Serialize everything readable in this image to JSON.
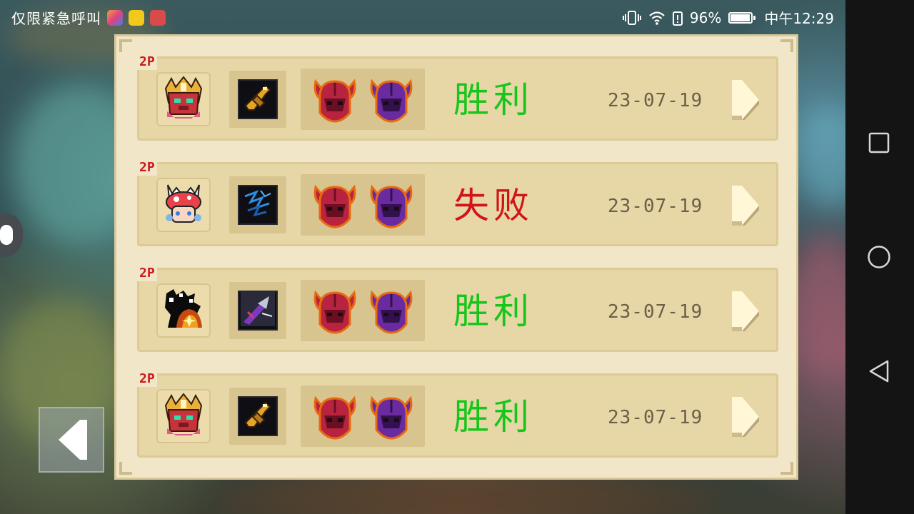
{
  "status_bar": {
    "carrier_text": "仅限紧急呼叫",
    "battery_percent": "96%",
    "battery_level": 0.96,
    "time": "中午12:29"
  },
  "records": [
    {
      "tag": "2P",
      "hero": "knight-red-hero",
      "weapon": "golden-gun-weapon",
      "result": "胜利",
      "result_color": "#17c61a",
      "date": "23-07-19"
    },
    {
      "tag": "2P",
      "hero": "mushroom-girl-hero",
      "weapon": "blue-lightning-weapon",
      "result": "失败",
      "result_color": "#d0141a",
      "date": "23-07-19"
    },
    {
      "tag": "2P",
      "hero": "shadow-flame-hero",
      "weapon": "drill-lance-weapon",
      "result": "胜利",
      "result_color": "#17c61a",
      "date": "23-07-19"
    },
    {
      "tag": "2P",
      "hero": "knight-red-hero",
      "weapon": "golden-gun-weapon",
      "result": "胜利",
      "result_color": "#17c61a",
      "date": "23-07-19"
    }
  ],
  "colors": {
    "panel_bg": "#f1e6c8",
    "row_bg": "#e8d7a6",
    "win": "#17c61a",
    "lose": "#d0141a",
    "tag_red": "#c81a1a"
  }
}
